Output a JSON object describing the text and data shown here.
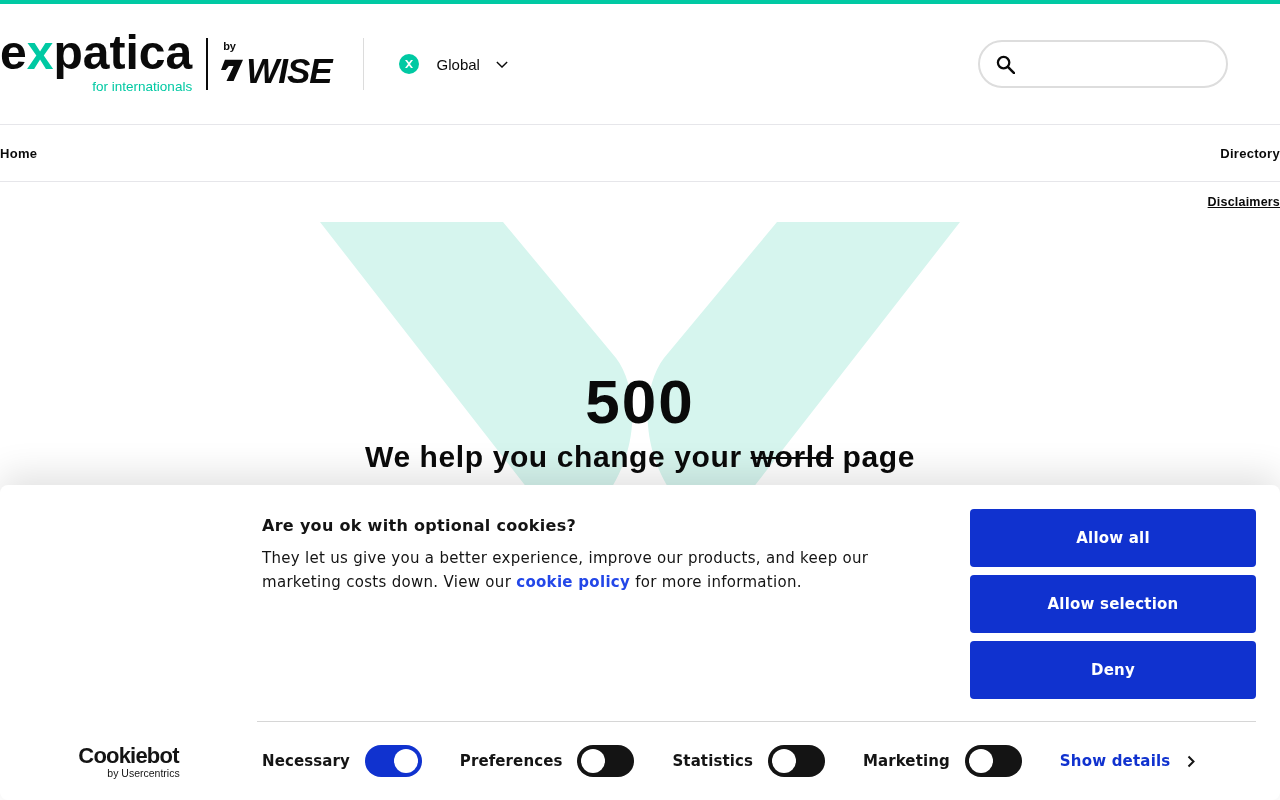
{
  "header": {
    "logo": {
      "name": [
        {
          "text": "e",
          "accent": false
        },
        {
          "text": "x",
          "accent": true
        },
        {
          "text": "patica",
          "accent": false
        }
      ],
      "tagline": "for internationals"
    },
    "partner": {
      "prefix": "by",
      "name": "WISE"
    },
    "region_selector": {
      "label": "Global"
    }
  },
  "nav": {
    "items": [
      {
        "label": "Home"
      },
      {
        "label": "Directory"
      }
    ]
  },
  "disclaimers_link": "Disclaimers",
  "error": {
    "code": "500",
    "message": [
      {
        "text": "We help you change your ",
        "struck": false
      },
      {
        "text": "world",
        "struck": true
      },
      {
        "text": " page",
        "struck": false
      }
    ]
  },
  "cookie_banner": {
    "title": "Are you ok with optional cookies?",
    "body": {
      "before": "They let us give you a better experience, improve our products, and keep our marketing costs down. View our ",
      "link": "cookie policy",
      "after": " for more information."
    },
    "buttons": [
      "Allow all",
      "Allow selection",
      "Deny"
    ],
    "categories": [
      {
        "label": "Necessary",
        "on": true
      },
      {
        "label": "Preferences",
        "on": false
      },
      {
        "label": "Statistics",
        "on": false
      },
      {
        "label": "Marketing",
        "on": false
      }
    ],
    "details_link": "Show details",
    "brand": {
      "name": "Cookiebot",
      "byline": "by Usercentrics"
    }
  }
}
